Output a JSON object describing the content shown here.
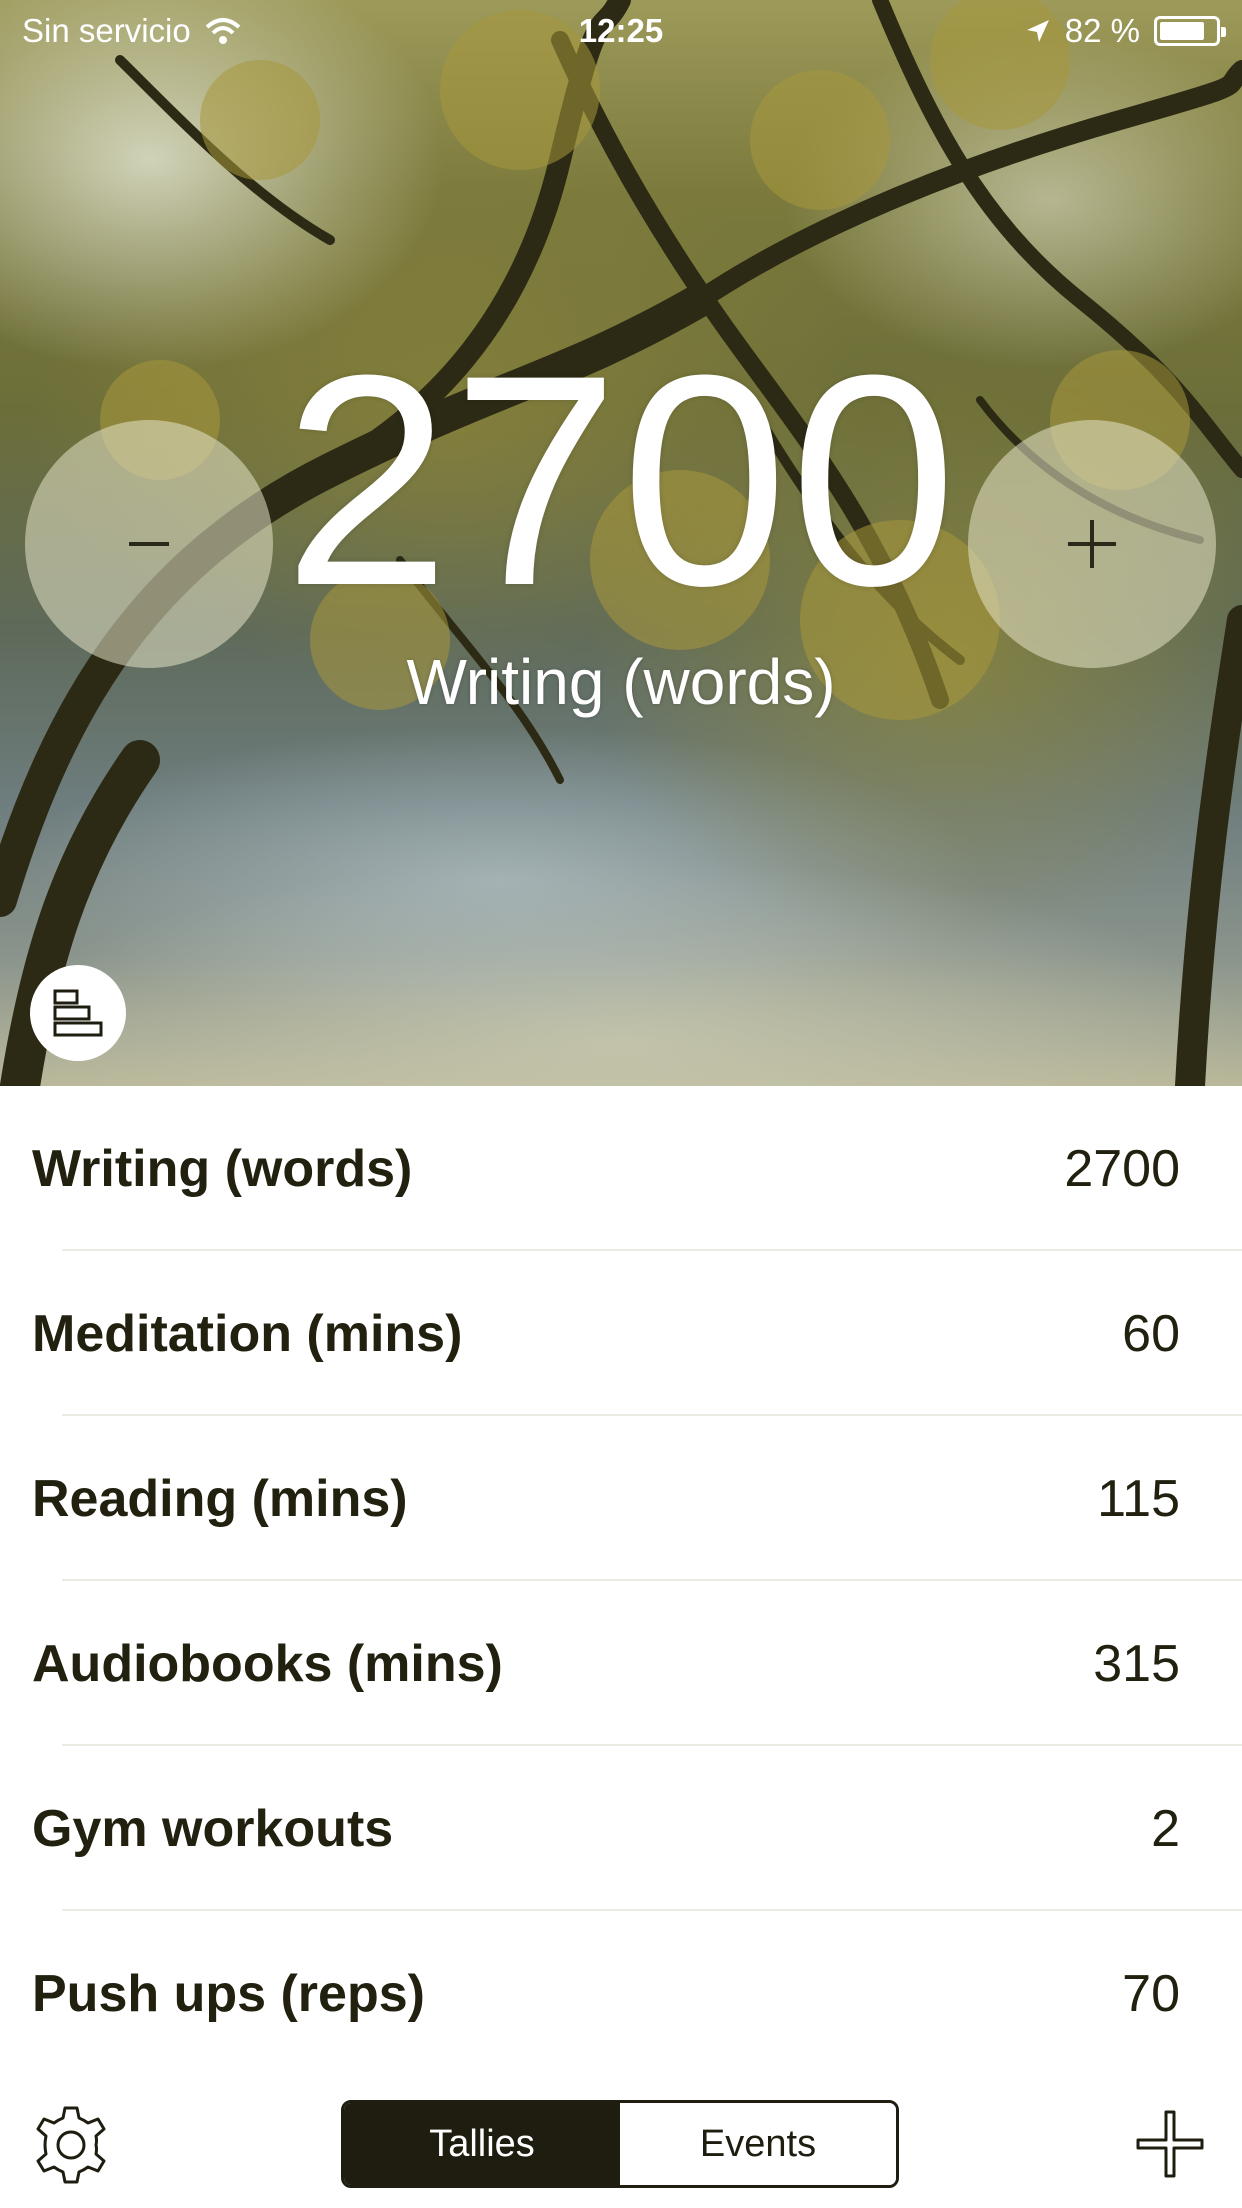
{
  "status_bar": {
    "carrier": "Sin servicio",
    "time": "12:25",
    "battery_percent": "82 %",
    "battery_level": 0.82
  },
  "hero": {
    "count": "2700",
    "label": "Writing (words)",
    "decrement_icon": "minus-icon",
    "increment_icon": "plus-icon",
    "stats_icon": "bar-chart-icon"
  },
  "tallies": [
    {
      "name": "Writing (words)",
      "value": "2700"
    },
    {
      "name": "Meditation (mins)",
      "value": "60"
    },
    {
      "name": "Reading (mins)",
      "value": "115"
    },
    {
      "name": "Audiobooks (mins)",
      "value": "315"
    },
    {
      "name": "Gym workouts",
      "value": "2"
    },
    {
      "name": "Push ups (reps)",
      "value": "70"
    }
  ],
  "tabbar": {
    "tabs": [
      "Tallies",
      "Events"
    ],
    "selected": "Tallies",
    "settings_icon": "gear-icon",
    "add_icon": "plus-icon"
  },
  "colors": {
    "accent": "#1f1d0f",
    "background": "#ffffff",
    "text": "#22200f"
  }
}
